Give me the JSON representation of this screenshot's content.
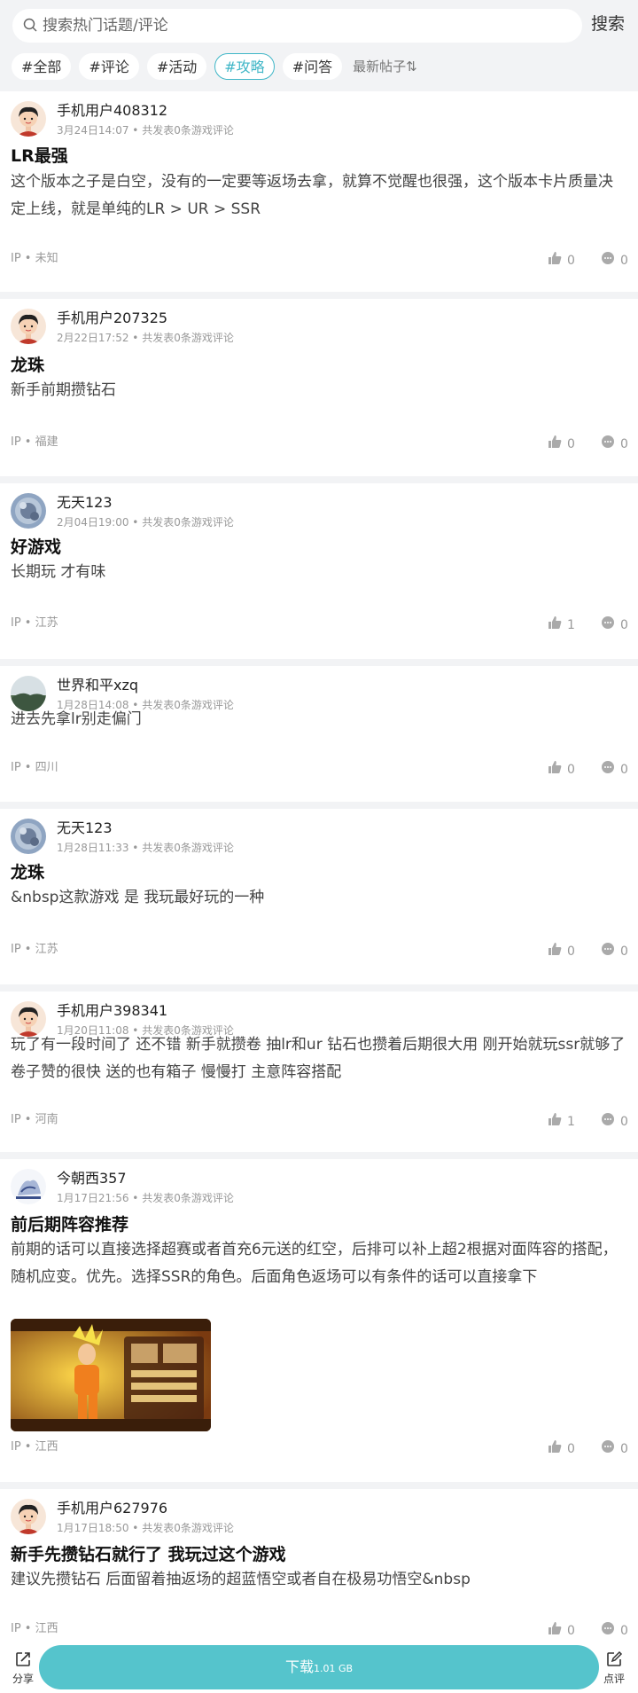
{
  "search": {
    "placeholder": "搜索热门话题/评论",
    "button": "搜索"
  },
  "tags": [
    "#全部",
    "#评论",
    "#活动",
    "#攻略",
    "#问答"
  ],
  "active_tag_index": 3,
  "sort_label": "最新帖子⇅",
  "posts": [
    {
      "user": "手机用户408312",
      "meta": "3月24日14:07 • 共发表0条游戏评论",
      "title": "LR最强",
      "body": "这个版本之子是白空，没有的一定要等返场去拿，就算不觉醒也很强，这个版本卡片质量决定上线，就是单纯的LR > UR > SSR",
      "ip": "IP • 未知",
      "likes": "0",
      "comments": "0",
      "avatar": "cartoon-boy"
    },
    {
      "user": "手机用户207325",
      "meta": "2月22日17:52 • 共发表0条游戏评论",
      "title": "龙珠",
      "body": "新手前期攒钻石",
      "ip": "IP • 福建",
      "likes": "0",
      "comments": "0",
      "avatar": "cartoon-boy"
    },
    {
      "user": "无天123",
      "meta": "2月04日19:00 • 共发表0条游戏评论",
      "title": "好游戏",
      "body": "长期玩 才有味",
      "ip": "IP • 江苏",
      "likes": "1",
      "comments": "0",
      "avatar": "photo-round"
    },
    {
      "user": "世界和平xzq",
      "meta": "1月28日14:08 • 共发表0条游戏评论",
      "title": "",
      "body": "进去先拿lr别走偏门",
      "ip": "IP • 四川",
      "likes": "0",
      "comments": "0",
      "avatar": "photo-landscape"
    },
    {
      "user": "无天123",
      "meta": "1月28日11:33 • 共发表0条游戏评论",
      "title": "龙珠",
      "body": "&nbsp这款游戏 是 我玩最好玩的一种",
      "ip": "IP • 江苏",
      "likes": "0",
      "comments": "0",
      "avatar": "photo-round"
    },
    {
      "user": "手机用户398341",
      "meta": "1月20日11:08 • 共发表0条游戏评论",
      "title": "",
      "body": "玩了有一段时间了 还不错 新手就攒卷 抽lr和ur 钻石也攒着后期很大用 刚开始就玩ssr就够了 卷子赞的很快 送的也有箱子 慢慢打 主意阵容搭配",
      "ip": "IP • 河南",
      "likes": "1",
      "comments": "0",
      "avatar": "cartoon-boy"
    },
    {
      "user": "今朝西357",
      "meta": "1月17日21:56 • 共发表0条游戏评论",
      "title": "前后期阵容推荐",
      "body": "前期的话可以直接选择超赛或者首充6元送的红空，后排可以补上超2根据对面阵容的搭配，随机应变。优先。选择SSR的角色。后面角色返场可以有条件的话可以直接拿下",
      "ip": "IP • 江西",
      "likes": "0",
      "comments": "0",
      "avatar": "photo-anime"
    },
    {
      "user": "手机用户627976",
      "meta": "1月17日18:50 • 共发表0条游戏评论",
      "title": "新手先攒钻石就行了 我玩过这个游戏",
      "body": "建议先攒钻石 后面留着抽返场的超蓝悟空或者自在极易功悟空&nbsp",
      "ip": "IP • 江西",
      "likes": "0",
      "comments": "0",
      "avatar": "cartoon-boy"
    }
  ],
  "bottom": {
    "share": "分享",
    "download": "下载",
    "size": "1.01 GB",
    "review": "点评"
  },
  "colors": {
    "accent": "#3fb6c7",
    "download_bg": "#55c4cc",
    "page_bg": "#f2f3f5"
  }
}
